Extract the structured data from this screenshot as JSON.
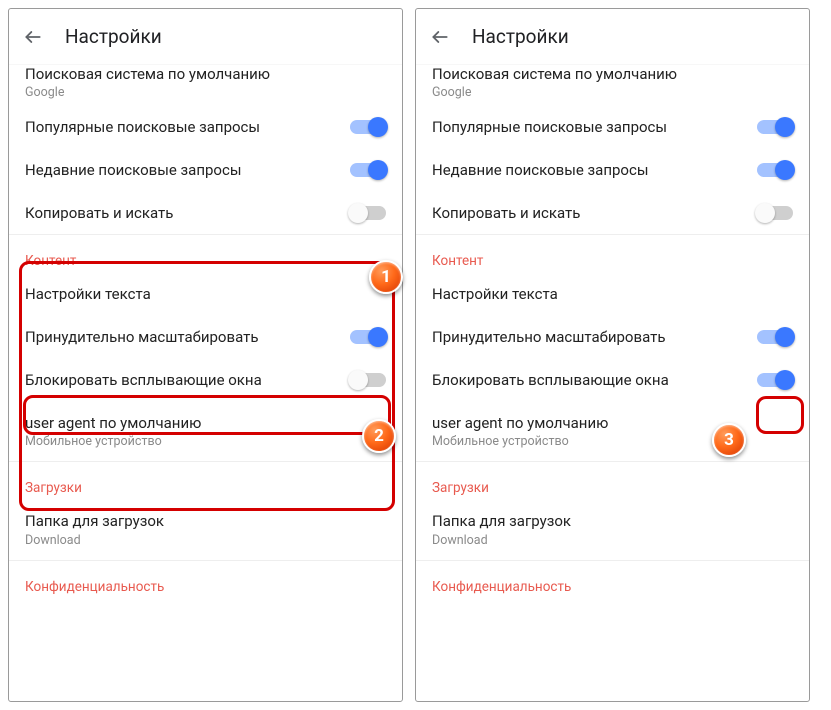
{
  "badges": {
    "b1": "1",
    "b2": "2",
    "b3": "3"
  },
  "left": {
    "header": {
      "title": "Настройки"
    },
    "searchEngine": {
      "label": "Поисковая система по умолчанию",
      "sub": "Google"
    },
    "popularQueries": {
      "label": "Популярные поисковые запросы",
      "on": true
    },
    "recentQueries": {
      "label": "Недавние поисковые запросы",
      "on": true
    },
    "copySearch": {
      "label": "Копировать и искать",
      "on": false
    },
    "contentHead": "Контент",
    "textSettings": {
      "label": "Настройки текста"
    },
    "forceZoom": {
      "label": "Принудительно масштабировать",
      "on": true
    },
    "blockPopups": {
      "label": "Блокировать всплывающие окна",
      "on": false
    },
    "userAgent": {
      "label": "user agent по умолчанию",
      "sub": "Мобильное устройство"
    },
    "downloadsHead": "Загрузки",
    "downloadFolder": {
      "label": "Папка для загрузок",
      "sub": "Download"
    },
    "privacyHead": "Конфиденциальность"
  },
  "right": {
    "header": {
      "title": "Настройки"
    },
    "searchEngine": {
      "label": "Поисковая система по умолчанию",
      "sub": "Google"
    },
    "popularQueries": {
      "label": "Популярные поисковые запросы",
      "on": true
    },
    "recentQueries": {
      "label": "Недавние поисковые запросы",
      "on": true
    },
    "copySearch": {
      "label": "Копировать и искать",
      "on": false
    },
    "contentHead": "Контент",
    "textSettings": {
      "label": "Настройки текста"
    },
    "forceZoom": {
      "label": "Принудительно масштабировать",
      "on": true
    },
    "blockPopups": {
      "label": "Блокировать всплывающие окна",
      "on": true
    },
    "userAgent": {
      "label": "user agent по умолчанию",
      "sub": "Мобильное устройство"
    },
    "downloadsHead": "Загрузки",
    "downloadFolder": {
      "label": "Папка для загрузок",
      "sub": "Download"
    },
    "privacyHead": "Конфиденциальность"
  }
}
